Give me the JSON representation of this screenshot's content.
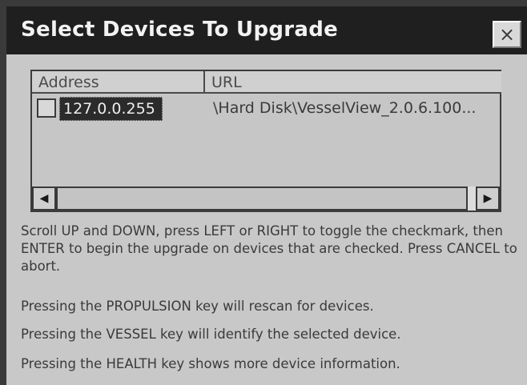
{
  "dialog": {
    "title": "Select Devices To Upgrade",
    "close_glyph": "×"
  },
  "device_list": {
    "columns": [
      "Address",
      "URL"
    ],
    "rows": [
      {
        "checked": false,
        "address": "127.0.0.255",
        "url": "\\Hard Disk\\VesselView_2.0.6.100..."
      }
    ],
    "scroll_left_glyph": "◀",
    "scroll_right_glyph": "▶"
  },
  "instructions": "Scroll UP and DOWN, press LEFT or RIGHT to toggle the checkmark, then ENTER to begin the upgrade on devices that are checked.  Press CANCEL to abort.",
  "notes": [
    "Pressing the PROPULSION key will rescan for devices.",
    "Pressing the VESSEL key will identify the selected device.",
    "Pressing the HEALTH key shows more device information."
  ],
  "colors": {
    "titlebar": "#1f1f1f",
    "background": "#c8c8c8",
    "selection": "#2b2b2b"
  },
  "icons": {
    "close": "close-icon",
    "scroll_left": "arrow-left-icon",
    "scroll_right": "arrow-right-icon"
  }
}
